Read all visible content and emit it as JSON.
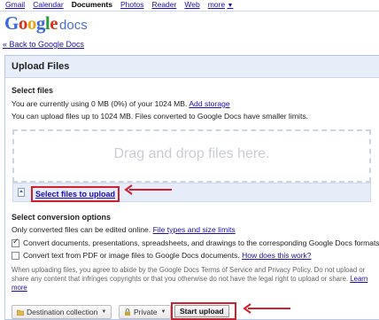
{
  "topnav": {
    "items": [
      "Gmail",
      "Calendar",
      "Documents",
      "Photos",
      "Reader",
      "Web"
    ],
    "more": "more",
    "active": "Documents"
  },
  "logo": {
    "google": "Google",
    "product": "docs"
  },
  "back_link": "« Back to Google Docs",
  "panel_title": "Upload Files",
  "select_files": {
    "heading": "Select files",
    "usage_text": "You are currently using 0 MB (0%) of your 1024 MB.",
    "add_storage": "Add storage",
    "limit_text": "You can upload files up to 1024 MB. Files converted to Google Docs have smaller limits."
  },
  "dropzone": {
    "text": "Drag and drop files here."
  },
  "select_link": "Select files to upload",
  "conversion": {
    "heading": "Select conversion options",
    "only_text": "Only converted files can be edited online.",
    "limits_link": "File types and size limits",
    "option1": {
      "label": "Convert documents, presentations, spreadsheets, and drawings to the corresponding Google Docs formats",
      "checked": true
    },
    "option2": {
      "label": "Convert text from PDF or image files to Google Docs documents.",
      "link": "How does this work?",
      "checked": false
    }
  },
  "terms": {
    "text": "When uploading files, you agree to abide by the Google Docs Terms of Service and Privacy Policy. Do not upload or share any content that infringes copyrights or that you otherwise do not have the legal right to upload or share.",
    "learn_more": "Learn more"
  },
  "buttons": {
    "destination": "Destination collection",
    "privacy": "Private",
    "start": "Start upload"
  },
  "colors": {
    "annotation": "#d0202e",
    "panel_header": "#e7eefa",
    "link": "#1a0dab"
  }
}
